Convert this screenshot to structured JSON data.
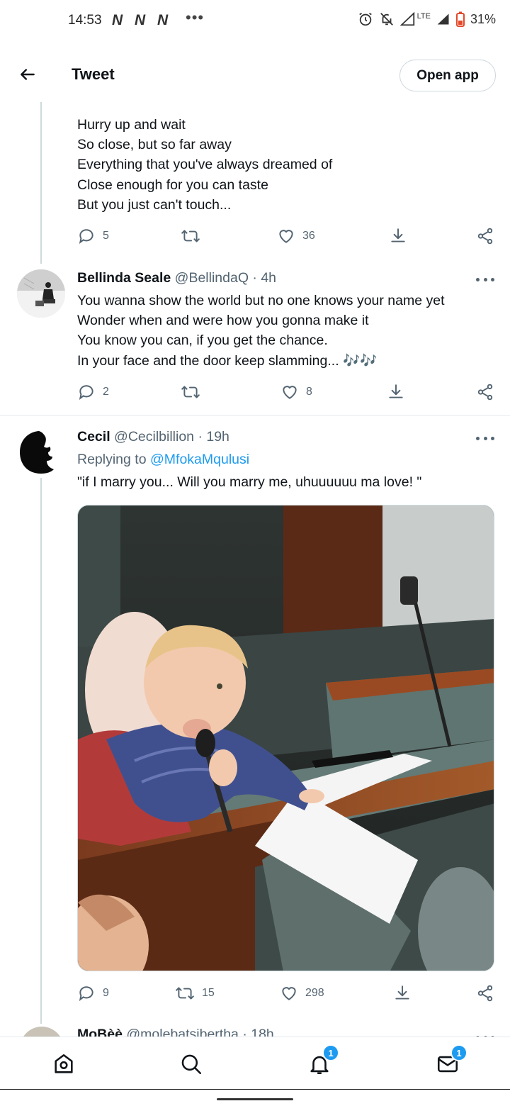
{
  "status_bar": {
    "time": "14:53",
    "notif_icons": [
      "N",
      "N",
      "N"
    ],
    "more_dots": "•••",
    "network": "LTE",
    "battery": "31%"
  },
  "header": {
    "title": "Tweet",
    "open_app_label": "Open app"
  },
  "tweets": [
    {
      "lines": [
        "Hurry up and wait",
        "So close, but so far away",
        "Everything that you've always dreamed of",
        "Close enough for you can taste",
        "But you just can't touch..."
      ],
      "replies": "5",
      "retweets": "",
      "likes": "36"
    },
    {
      "name": "Bellinda Seale",
      "handle": "@BellindaQ · 4h",
      "lines": [
        "You wanna show the world but no one knows your name yet",
        "Wonder when and were how you gonna make it",
        "You know you can, if you get the chance.",
        "In your face and the door keep slamming... "
      ],
      "emoji": "🎶🎶",
      "replies": "2",
      "retweets": "",
      "likes": "8"
    },
    {
      "name": "Cecil",
      "handle": "@Cecilbillion · 19h",
      "replying_prefix": "Replying to ",
      "replying_to": "@MfokaMqulusi",
      "lines": [
        "\"if I marry you... Will you marry me, uhuuuuuu ma love! \""
      ],
      "replies": "9",
      "retweets": "15",
      "likes": "298"
    },
    {
      "name": "MoBèè",
      "handle": "@molebatsibertha · 18h"
    }
  ],
  "bottom_nav": {
    "notifications_badge": "1",
    "messages_badge": "1"
  },
  "colors": {
    "accent": "#1d9bf0",
    "text": "#0f1419",
    "secondary": "#536471",
    "border": "#cfd9de"
  }
}
